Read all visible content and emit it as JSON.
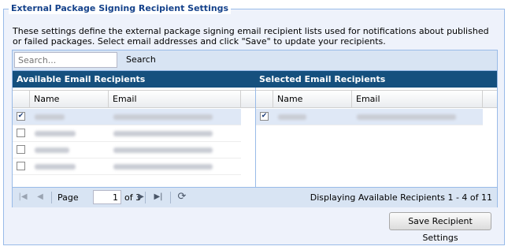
{
  "settings": {
    "legend": "External Package Signing Recipient Settings",
    "description": "These settings define the external package signing email recipient lists used for notifications about published or failed packages. Select email addresses and click \"Save\" to update your recipients."
  },
  "search": {
    "placeholder": "Search...",
    "value": "",
    "button_label": "Search"
  },
  "available": {
    "title": "Available Email Recipients",
    "columns": [
      "Name",
      "Email"
    ],
    "rows": [
      {
        "checked": true
      },
      {
        "checked": false
      },
      {
        "checked": false
      },
      {
        "checked": false
      }
    ]
  },
  "selected": {
    "title": "Selected Email Recipients",
    "columns": [
      "Name",
      "Email"
    ],
    "rows": [
      {
        "checked": true
      }
    ]
  },
  "paging": {
    "page_label": "Page",
    "current_page": "1",
    "of_label": "of 3",
    "display_text": "Displaying Available Recipients 1 - 4 of 11"
  },
  "actions": {
    "save_label": "Save Recipient Settings"
  },
  "colors": {
    "header_bar": "#15507e",
    "panel_border": "#99bbe8",
    "legend_text": "#15428b",
    "selected_row": "#dfe8f6"
  },
  "icons": [
    "first-page-icon",
    "prev-page-icon",
    "next-page-icon",
    "last-page-icon",
    "refresh-icon",
    "checkbox-icon"
  ]
}
